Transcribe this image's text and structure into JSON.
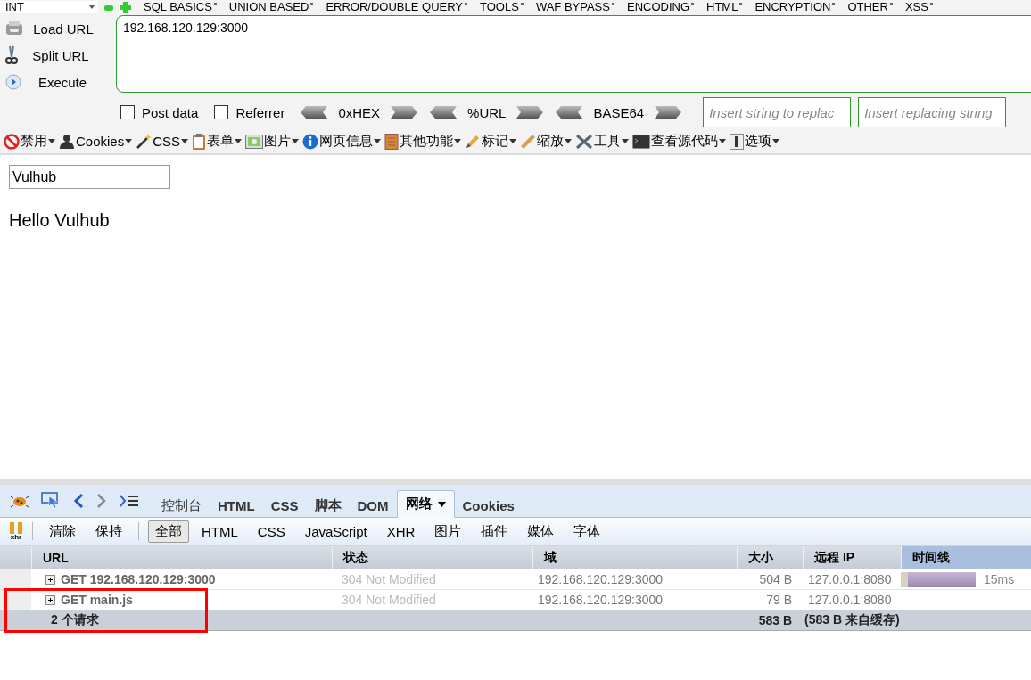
{
  "hackbar": {
    "encoding_select": "INT",
    "menu": [
      "SQL BASICS",
      "UNION BASED",
      "ERROR/DOUBLE QUERY",
      "TOOLS",
      "WAF BYPASS",
      "ENCODING",
      "HTML",
      "ENCRYPTION",
      "OTHER",
      "XSS"
    ],
    "actions": [
      "Load URL",
      "Split URL",
      "Execute"
    ],
    "url": "192.168.120.129:3000",
    "options": [
      {
        "label": "Post data",
        "checked": false
      },
      {
        "label": "Referrer",
        "checked": false
      }
    ],
    "encoders": [
      "0xHEX",
      "%URL",
      "BASE64"
    ],
    "replace_fields": [
      {
        "placeholder": "Insert string to replac"
      },
      {
        "placeholder": "Insert replacing string"
      }
    ]
  },
  "webdev_toolbar": [
    "禁用",
    "Cookies",
    "CSS",
    "表单",
    "图片",
    "网页信息",
    "其他功能",
    "标记",
    "缩放",
    "工具",
    "查看源代码",
    "选项"
  ],
  "page": {
    "input_value": "Vulhub",
    "heading": "Hello Vulhub"
  },
  "firebug": {
    "tabs": [
      {
        "label": "控制台",
        "selected": false
      },
      {
        "label": "HTML",
        "selected": false
      },
      {
        "label": "CSS",
        "selected": false
      },
      {
        "label": "脚本",
        "selected": false
      },
      {
        "label": "DOM",
        "selected": false
      },
      {
        "label": "网络",
        "selected": true,
        "dropdown": true
      },
      {
        "label": "Cookies",
        "selected": false
      }
    ],
    "xhr_toggle": "xhr",
    "actions": [
      "清除",
      "保持"
    ],
    "filters": [
      {
        "label": "全部",
        "selected": true
      },
      {
        "label": "HTML",
        "selected": false
      },
      {
        "label": "CSS",
        "selected": false
      },
      {
        "label": "JavaScript",
        "selected": false
      },
      {
        "label": "XHR",
        "selected": false
      },
      {
        "label": "图片",
        "selected": false
      },
      {
        "label": "插件",
        "selected": false
      },
      {
        "label": "媒体",
        "selected": false
      },
      {
        "label": "字体",
        "selected": false
      }
    ],
    "columns": [
      "URL",
      "状态",
      "域",
      "大小",
      "远程 IP",
      "时间线"
    ],
    "rows": [
      {
        "url": "GET 192.168.120.129:3000",
        "status": "304 Not Modified",
        "domain": "192.168.120.129:3000",
        "size": "504 B",
        "remote_ip": "127.0.0.1:8080",
        "timing": "15ms",
        "expanded": false
      },
      {
        "url": "GET main.js",
        "status": "304 Not Modified",
        "domain": "192.168.120.129:3000",
        "size": "79 B",
        "remote_ip": "127.0.0.1:8080",
        "expanded": false
      }
    ],
    "summary": {
      "count": "2 个请求",
      "size": "583 B",
      "cached": "(583 B 来自缓存)"
    }
  },
  "annotation_box": true
}
